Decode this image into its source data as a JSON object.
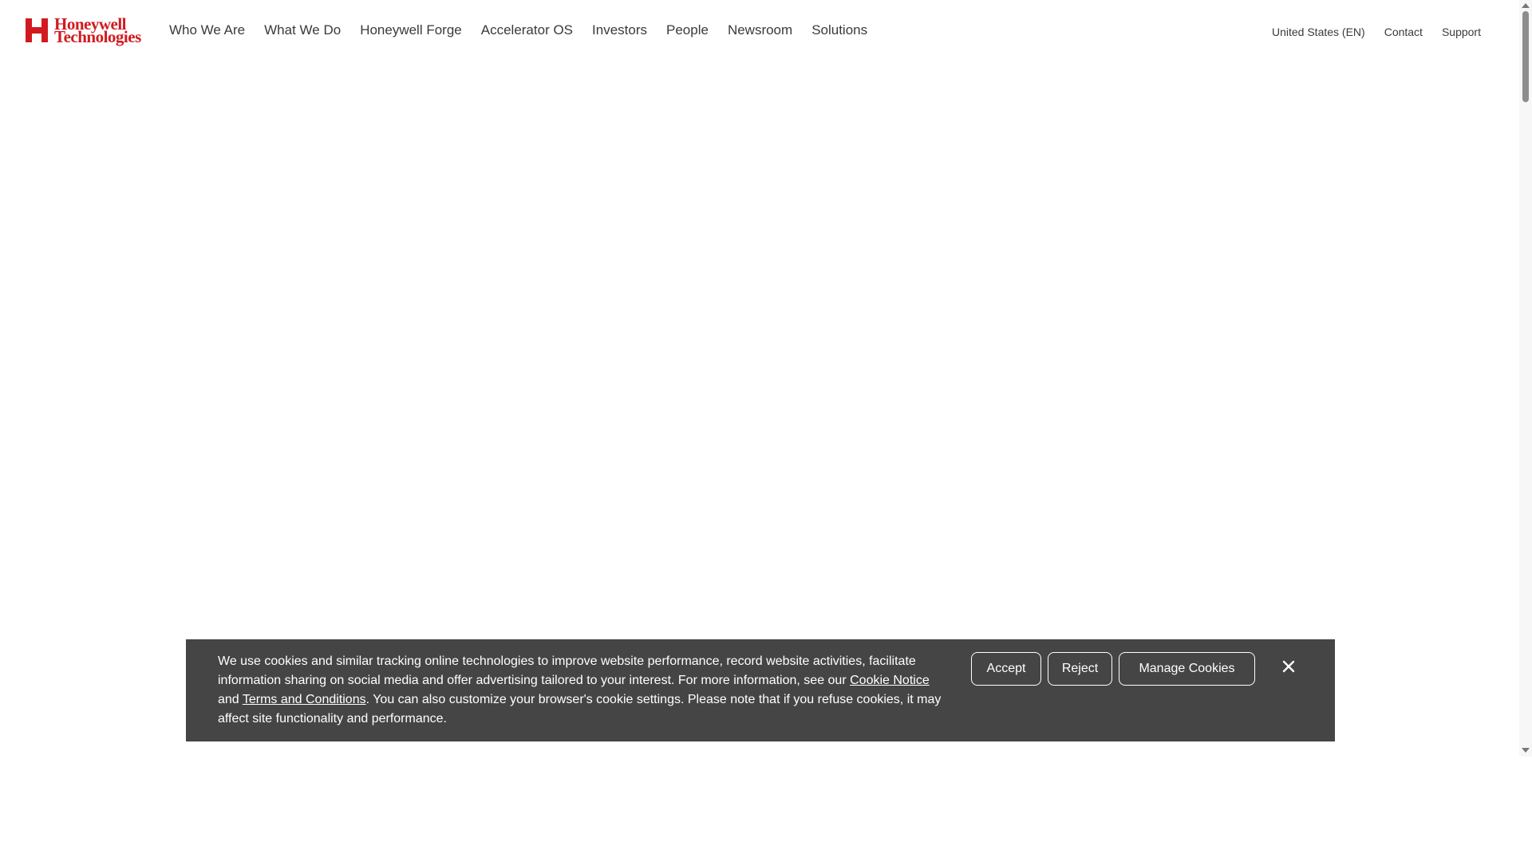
{
  "brand": {
    "name_line1": "Honeywell",
    "name_line2": "Technologies",
    "color": "#d11a1f"
  },
  "nav": {
    "items": [
      {
        "label": "Who We Are"
      },
      {
        "label": "What We Do"
      },
      {
        "label": "Honeywell Forge"
      },
      {
        "label": "Accelerator OS"
      },
      {
        "label": "Investors"
      },
      {
        "label": "People"
      },
      {
        "label": "Newsroom"
      },
      {
        "label": "Solutions"
      }
    ]
  },
  "utility": {
    "region": "United States (EN)",
    "contact": "Contact",
    "support": "Support"
  },
  "cookie": {
    "text_1": "We use cookies and similar tracking online technologies to improve website performance, record website activities, facilitate information sharing on social media and offer advertising tailored to your interest. For more information, see our ",
    "cookie_notice_link": "Cookie Notice",
    "text_2": " and ",
    "terms_link": "Terms and Conditions",
    "text_3": ". You can also customize your browser's cookie settings. Please note that if you refuse cookies, it may affect site functionality and performance.",
    "accept_label": "Accept",
    "reject_label": "Reject",
    "manage_label": "Manage Cookies",
    "close_icon": "close-icon",
    "background": "#454545"
  }
}
